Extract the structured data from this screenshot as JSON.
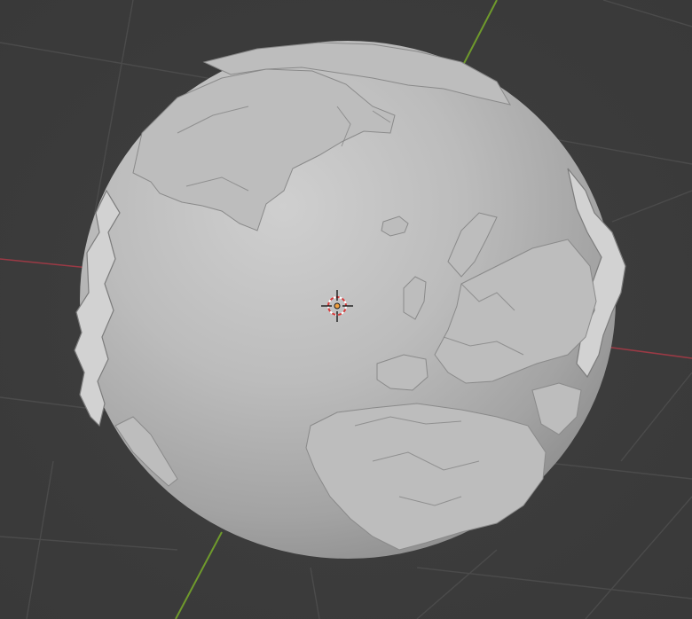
{
  "viewport": {
    "mode": "3d-viewport",
    "shading": "solid",
    "background_color": "#3d3d3d"
  },
  "axes": {
    "x_axis_color": "#9b3a45",
    "y_axis_color": "#6f9a2c"
  },
  "object": {
    "type": "displaced-sphere",
    "depicts": "earth-relief-globe",
    "surface_color": "#b5b5b5"
  },
  "cursor": {
    "icon": "3d-cursor-icon",
    "ring_colors": [
      "#d63b3b",
      "#ffffff"
    ]
  }
}
